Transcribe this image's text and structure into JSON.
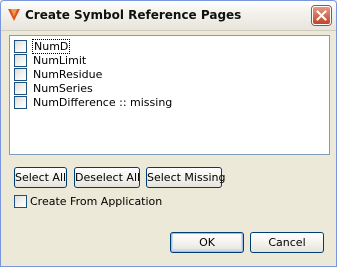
{
  "window": {
    "title": "Create Symbol Reference Pages"
  },
  "list": {
    "items": [
      {
        "label": "NumD",
        "checked": false
      },
      {
        "label": "NumLimit",
        "checked": false
      },
      {
        "label": "NumResidue",
        "checked": false
      },
      {
        "label": "NumSeries",
        "checked": false
      },
      {
        "label": "NumDifference :: missing",
        "checked": false
      }
    ]
  },
  "buttons": {
    "select_all": "Select All",
    "deselect_all": "Deselect All",
    "select_missing": "Select Missing",
    "ok": "OK",
    "cancel": "Cancel"
  },
  "options": {
    "create_from_application": "Create From Application",
    "create_from_application_checked": false
  },
  "colors": {
    "accent": "#003c74",
    "background": "#ece9d8",
    "close_button": "#c1452a"
  },
  "icons": {
    "app": "app-logo-icon",
    "close": "close-icon"
  }
}
